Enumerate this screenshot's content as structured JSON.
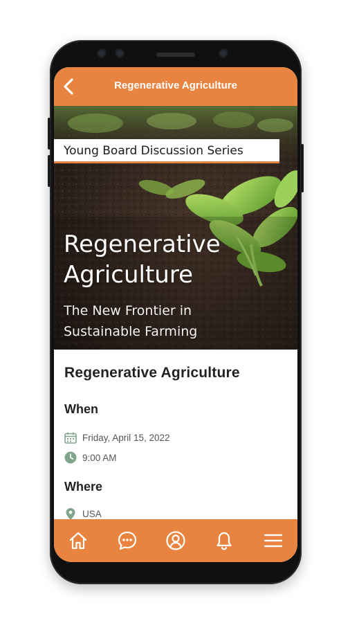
{
  "header": {
    "title": "Regenerative Agriculture"
  },
  "hero": {
    "series": "Young Board Discussion Series",
    "title_line1": "Regenerative",
    "title_line2": "Agriculture",
    "subtitle_line1": "The New Frontier in",
    "subtitle_line2": "Sustainable Farming"
  },
  "event": {
    "title": "Regenerative Agriculture",
    "when_label": "When",
    "date": "Friday, April 15, 2022",
    "time": "9:00 AM",
    "where_label": "Where",
    "location": "USA"
  },
  "bottom_nav": {
    "items": [
      "home-icon",
      "chat-icon",
      "profile-icon",
      "bell-icon",
      "menu-icon"
    ]
  },
  "colors": {
    "accent": "#E8843F",
    "icon_green": "#7FA58D"
  }
}
